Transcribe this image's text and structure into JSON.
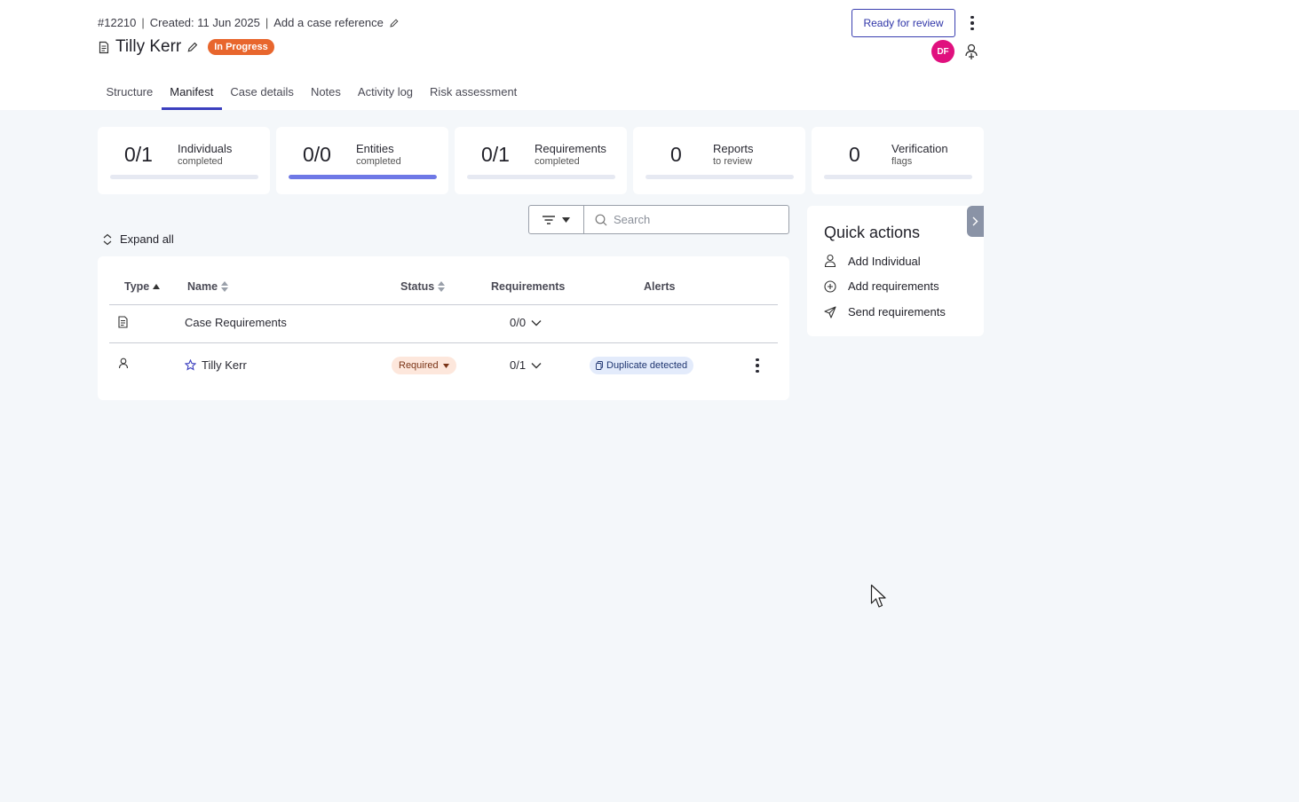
{
  "case": {
    "id": "#12210",
    "created": "Created: 11 Jun 2025",
    "reference_link": "Add a case reference",
    "title": "Tilly Kerr",
    "status": "In Progress"
  },
  "header": {
    "review_button": "Ready for review",
    "avatar_initials": "DF"
  },
  "tabs": [
    {
      "label": "Structure"
    },
    {
      "label": "Manifest",
      "active": true
    },
    {
      "label": "Case details"
    },
    {
      "label": "Notes"
    },
    {
      "label": "Activity log"
    },
    {
      "label": "Risk assessment"
    }
  ],
  "stats": [
    {
      "value": "0/1",
      "label": "Individuals",
      "sub": "completed",
      "progress": 0
    },
    {
      "value": "0/0",
      "label": "Entities",
      "sub": "completed",
      "progress": 1
    },
    {
      "value": "0/1",
      "label": "Requirements",
      "sub": "completed",
      "progress": 0
    },
    {
      "value": "0",
      "label": "Reports",
      "sub": "to review",
      "progress": 0
    },
    {
      "value": "0",
      "label": "Verification",
      "sub": "flags",
      "progress": 0
    }
  ],
  "toolbar": {
    "search_placeholder": "Search",
    "expand_all": "Expand all"
  },
  "table": {
    "columns": {
      "type": "Type",
      "name": "Name",
      "status": "Status",
      "requirements": "Requirements",
      "alerts": "Alerts"
    },
    "rows": [
      {
        "name": "Case Requirements",
        "requirements": "0/0"
      },
      {
        "name": "Tilly Kerr",
        "status": "Required",
        "requirements": "0/1",
        "alert": "Duplicate detected"
      }
    ]
  },
  "quick_actions": {
    "title": "Quick actions",
    "items": [
      {
        "label": "Add Individual"
      },
      {
        "label": "Add requirements"
      },
      {
        "label": "Send requirements"
      }
    ]
  },
  "colors": {
    "accent": "#3b3fbf",
    "status_in_progress": "#e8662d",
    "avatar": "#e0107e",
    "progress_fill": "#6e78e6"
  }
}
